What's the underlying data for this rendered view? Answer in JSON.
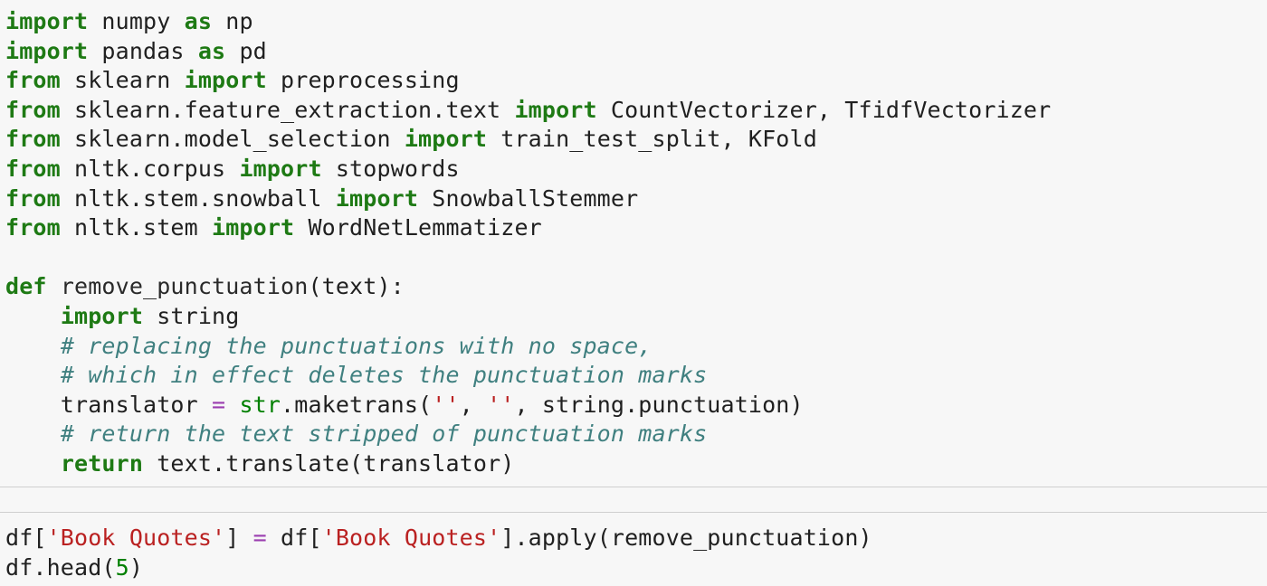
{
  "cells": [
    {
      "lines": [
        [
          [
            "kw",
            "import"
          ],
          [
            "t",
            " numpy "
          ],
          [
            "kw",
            "as"
          ],
          [
            "t",
            " np"
          ]
        ],
        [
          [
            "kw",
            "import"
          ],
          [
            "t",
            " pandas "
          ],
          [
            "kw",
            "as"
          ],
          [
            "t",
            " pd"
          ]
        ],
        [
          [
            "kw",
            "from"
          ],
          [
            "t",
            " sklearn "
          ],
          [
            "kw",
            "import"
          ],
          [
            "t",
            " preprocessing"
          ]
        ],
        [
          [
            "kw",
            "from"
          ],
          [
            "t",
            " sklearn.feature_extraction.text "
          ],
          [
            "kw",
            "import"
          ],
          [
            "t",
            " CountVectorizer, TfidfVectorizer"
          ]
        ],
        [
          [
            "kw",
            "from"
          ],
          [
            "t",
            " sklearn.model_selection "
          ],
          [
            "kw",
            "import"
          ],
          [
            "t",
            " train_test_split, KFold"
          ]
        ],
        [
          [
            "kw",
            "from"
          ],
          [
            "t",
            " nltk.corpus "
          ],
          [
            "kw",
            "import"
          ],
          [
            "t",
            " stopwords"
          ]
        ],
        [
          [
            "kw",
            "from"
          ],
          [
            "t",
            " nltk.stem.snowball "
          ],
          [
            "kw",
            "import"
          ],
          [
            "t",
            " SnowballStemmer"
          ]
        ],
        [
          [
            "kw",
            "from"
          ],
          [
            "t",
            " nltk.stem "
          ],
          [
            "kw",
            "import"
          ],
          [
            "t",
            " WordNetLemmatizer"
          ]
        ],
        [],
        [
          [
            "kw",
            "def"
          ],
          [
            "t",
            " "
          ],
          [
            "fn",
            "remove_punctuation"
          ],
          [
            "t",
            "(text):"
          ]
        ],
        [
          [
            "t",
            "    "
          ],
          [
            "kw",
            "import"
          ],
          [
            "t",
            " string"
          ]
        ],
        [
          [
            "t",
            "    "
          ],
          [
            "cm",
            "# replacing the punctuations with no space,"
          ]
        ],
        [
          [
            "t",
            "    "
          ],
          [
            "cm",
            "# which in effect deletes the punctuation marks"
          ]
        ],
        [
          [
            "t",
            "    translator "
          ],
          [
            "op",
            "="
          ],
          [
            "t",
            " "
          ],
          [
            "bi",
            "str"
          ],
          [
            "t",
            ".maketrans("
          ],
          [
            "str",
            "''"
          ],
          [
            "t",
            ", "
          ],
          [
            "str",
            "''"
          ],
          [
            "t",
            ", string.punctuation)"
          ]
        ],
        [
          [
            "t",
            "    "
          ],
          [
            "cm",
            "# return the text stripped of punctuation marks"
          ]
        ],
        [
          [
            "t",
            "    "
          ],
          [
            "kw",
            "return"
          ],
          [
            "t",
            " text.translate(translator)"
          ]
        ]
      ]
    },
    {
      "lines": [
        [
          [
            "t",
            "df["
          ],
          [
            "str",
            "'Book Quotes'"
          ],
          [
            "t",
            "] "
          ],
          [
            "op",
            "="
          ],
          [
            "t",
            " df["
          ],
          [
            "str",
            "'Book Quotes'"
          ],
          [
            "t",
            "].apply(remove_punctuation)"
          ]
        ],
        [
          [
            "t",
            "df.head("
          ],
          [
            "num",
            "5"
          ],
          [
            "t",
            ")"
          ]
        ]
      ]
    }
  ]
}
